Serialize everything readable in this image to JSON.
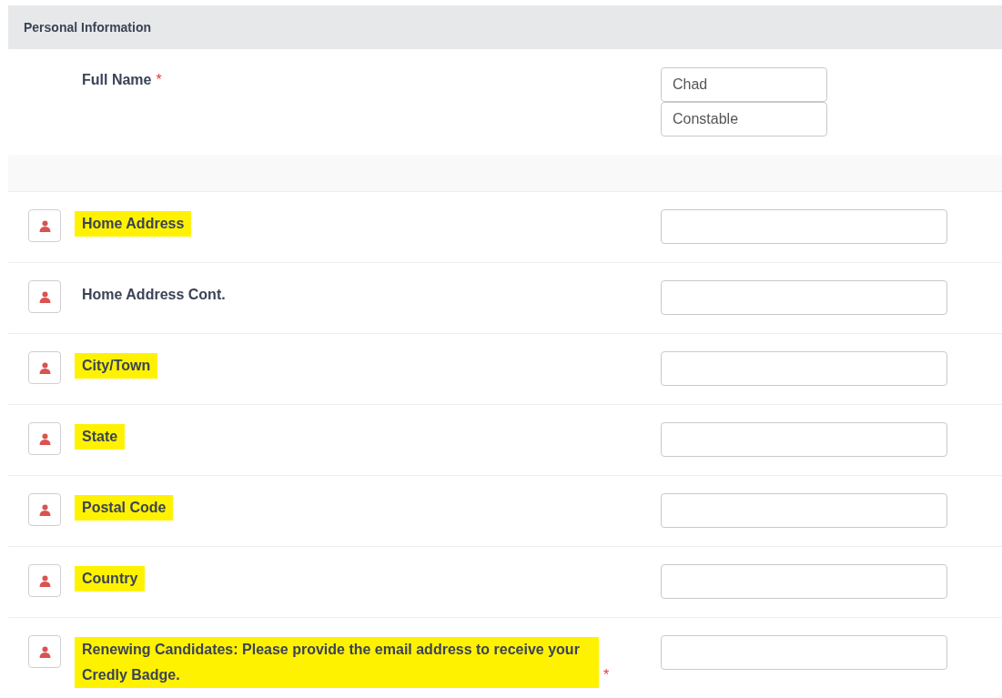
{
  "section": {
    "title": "Personal Information"
  },
  "full_name": {
    "label": "Full Name",
    "required_mark": "*",
    "first": "Chad",
    "last": "Constable"
  },
  "fields": [
    {
      "label": "Home Address",
      "highlighted": true
    },
    {
      "label": "Home Address Cont.",
      "highlighted": false
    },
    {
      "label": "City/Town",
      "highlighted": true
    },
    {
      "label": "State",
      "highlighted": true
    },
    {
      "label": "Postal Code",
      "highlighted": true
    },
    {
      "label": "Country",
      "highlighted": true
    },
    {
      "label": "Renewing Candidates: Please provide the email address to receive your Credly Badge.",
      "highlighted": true,
      "required_mark": "*"
    }
  ]
}
